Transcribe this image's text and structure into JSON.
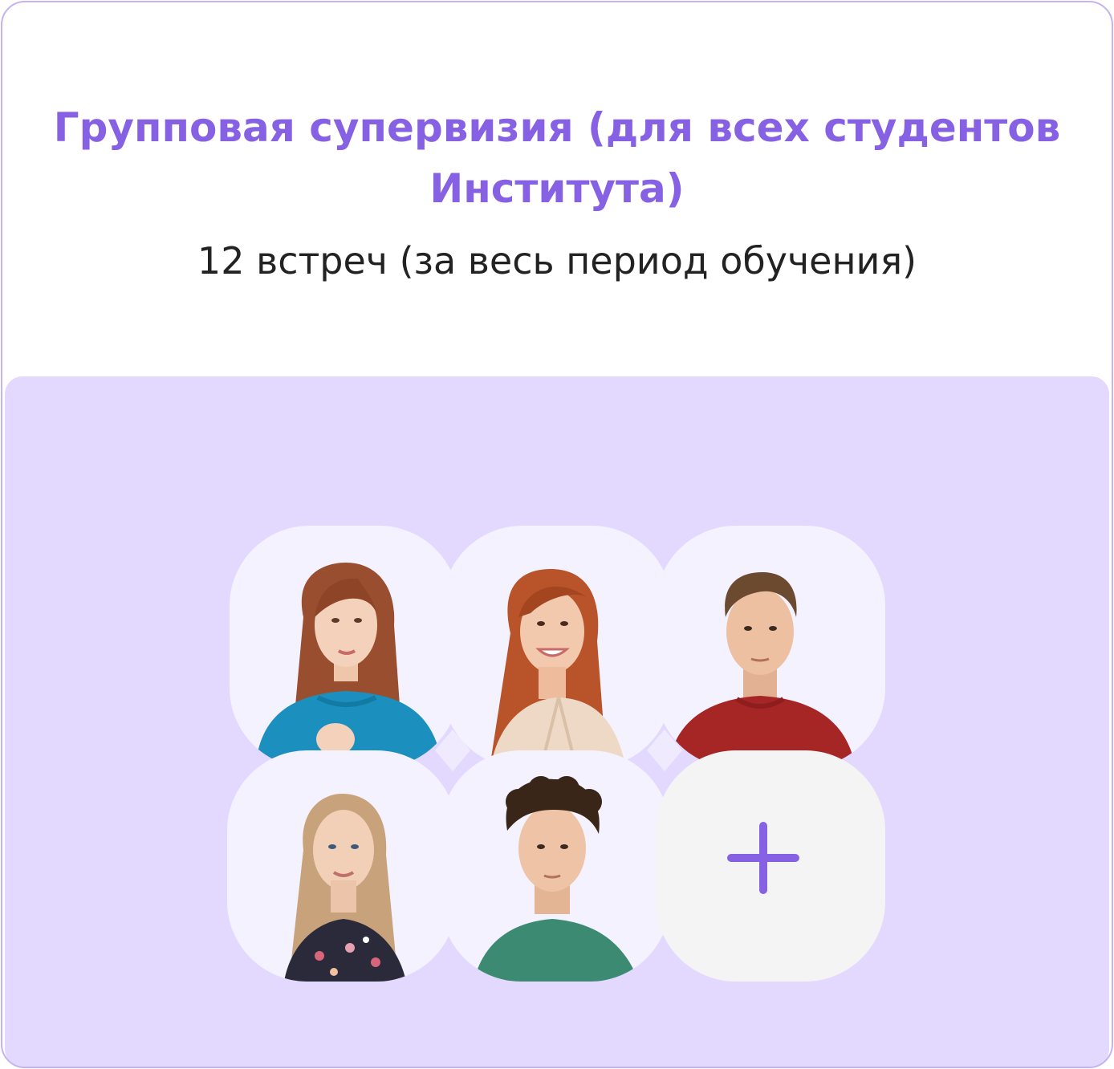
{
  "card": {
    "title": "Групповая супервизия (для всех студентов Института)",
    "subtitle": "12 встреч (за весь период обучения)"
  },
  "participants": [
    {
      "icon": "woman-portrait-icon"
    },
    {
      "icon": "woman-portrait-icon"
    },
    {
      "icon": "man-portrait-icon"
    },
    {
      "icon": "woman-portrait-icon"
    },
    {
      "icon": "man-portrait-icon"
    }
  ],
  "add_tile": {
    "icon": "plus-icon"
  },
  "colors": {
    "accent": "#8761e4",
    "border": "#c3b3f3",
    "panel": "#e3d9ff",
    "tile": "#f5f2ff",
    "add_tile": "#f4f4f4",
    "diamond": "#f0eaff"
  }
}
